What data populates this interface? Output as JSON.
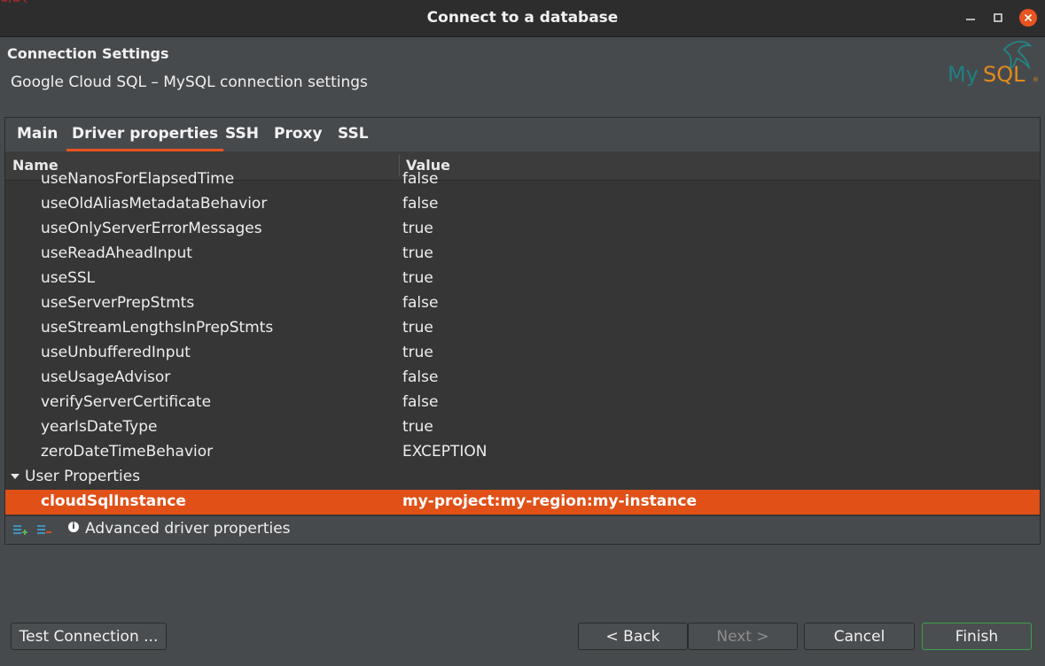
{
  "window": {
    "title": "Connect to a database"
  },
  "header": {
    "section_title": "Connection Settings",
    "subtitle": "Google Cloud SQL – MySQL connection settings"
  },
  "tabs": [
    {
      "label": "Main"
    },
    {
      "label": "Driver properties"
    },
    {
      "label": "SSH"
    },
    {
      "label": "Proxy"
    },
    {
      "label": "SSL"
    }
  ],
  "table": {
    "columns": {
      "name": "Name",
      "value": "Value"
    },
    "partial_row": {
      "name": "useNanosForElapsedTime",
      "value": "false"
    },
    "rows": [
      {
        "name": "useOldAliasMetadataBehavior",
        "value": "false"
      },
      {
        "name": "useOnlyServerErrorMessages",
        "value": "true"
      },
      {
        "name": "useReadAheadInput",
        "value": "true"
      },
      {
        "name": "useSSL",
        "value": "true"
      },
      {
        "name": "useServerPrepStmts",
        "value": "false"
      },
      {
        "name": "useStreamLengthsInPrepStmts",
        "value": "true"
      },
      {
        "name": "useUnbufferedInput",
        "value": "true"
      },
      {
        "name": "useUsageAdvisor",
        "value": "false"
      },
      {
        "name": "verifyServerCertificate",
        "value": "false"
      },
      {
        "name": "yearIsDateType",
        "value": "true"
      },
      {
        "name": "zeroDateTimeBehavior",
        "value": "EXCEPTION"
      }
    ],
    "group": {
      "label": "User Properties"
    },
    "selected_row": {
      "name": "cloudSqlInstance",
      "value": "my-project:my-region:my-instance"
    }
  },
  "footer": {
    "advanced_label": "Advanced driver properties"
  },
  "buttons": {
    "test_connection": "Test Connection ...",
    "back": "< Back",
    "next": "Next >",
    "cancel": "Cancel",
    "finish": "Finish"
  },
  "colors": {
    "accent": "#e95420",
    "selection": "#e05017",
    "finish_border": "#3f9e4e"
  },
  "icons": {
    "add": "add-property-icon",
    "remove": "remove-property-icon",
    "info": "info-icon",
    "logo": "mysql-logo"
  }
}
